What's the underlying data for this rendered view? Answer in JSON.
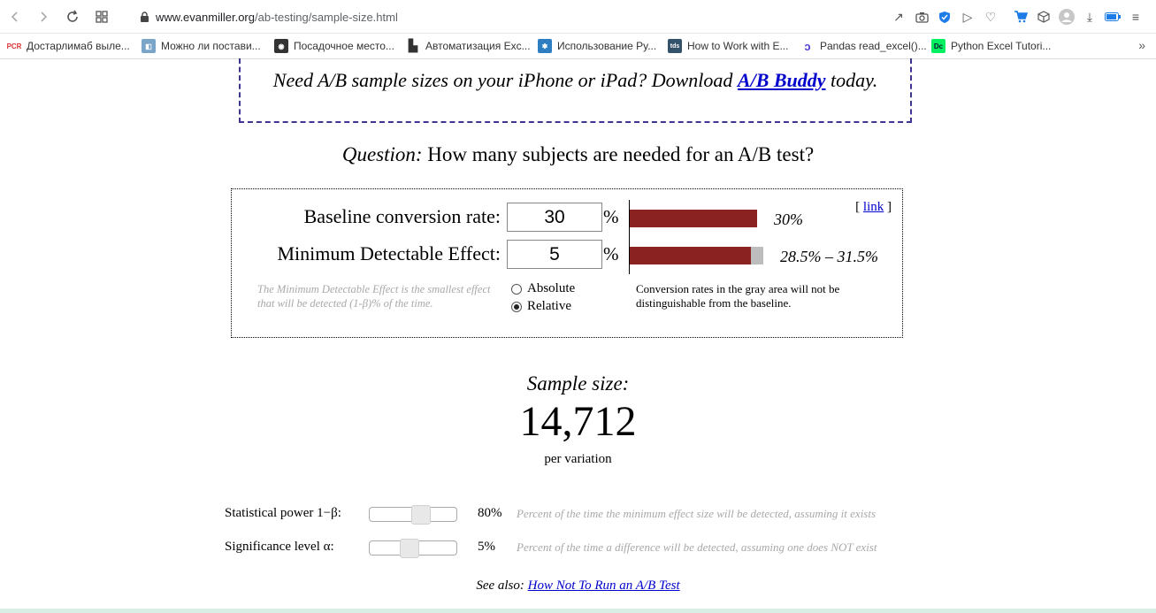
{
  "browser": {
    "url_domain": "www.evanmiller.org",
    "url_path": "/ab-testing/sample-size.html",
    "bookmarks": [
      {
        "label": "Достарлимаб выле...",
        "icon": "pcr-icon"
      },
      {
        "label": "Можно ли постави...",
        "icon": "page-icon"
      },
      {
        "label": "Посадочное место...",
        "icon": "camera-icon"
      },
      {
        "label": "Автоматизация Exc...",
        "icon": "document-icon"
      },
      {
        "label": "Использование Py...",
        "icon": "star-icon"
      },
      {
        "label": "How to Work with E...",
        "icon": "tds-icon"
      },
      {
        "label": "Pandas read_excel()...",
        "icon": "dataquest-icon"
      },
      {
        "label": "Python Excel Tutori...",
        "icon": "datacamp-icon"
      }
    ],
    "more_label": "»"
  },
  "promo": {
    "text_before": "Need A/B sample sizes on your iPhone or iPad? Download ",
    "link": "A/B Buddy",
    "text_after": " today."
  },
  "question": {
    "label": "Question:",
    "text": " How many subjects are needed for an A/B test?"
  },
  "calculator": {
    "link_open": "[ ",
    "link_label": "link",
    "link_close": " ]",
    "baseline": {
      "label": "Baseline conversion rate:",
      "value": "30",
      "unit": "%",
      "bar_text": "30%",
      "rate": 0.3
    },
    "mde": {
      "label": "Minimum Detectable Effect:",
      "value": "5",
      "unit": "%",
      "bar_text": "28.5% – 31.5%",
      "low": 0.285,
      "high": 0.315
    },
    "hint": "The Minimum Detectable Effect is the smallest effect that will be detected (1-β)% of the time.",
    "options": [
      "Absolute",
      "Relative"
    ],
    "selected_option": "Relative",
    "gray_note": "Conversion rates in the gray area will not be distinguishable from the baseline."
  },
  "result": {
    "label": "Sample size:",
    "value": "14,712",
    "sub": "per variation"
  },
  "params": {
    "power": {
      "label": "Statistical power 1−β:",
      "value": "80%",
      "level": 0.8,
      "desc": "Percent of the time the minimum effect size will be detected, assuming it exists"
    },
    "significance": {
      "label": "Significance level α:",
      "value": "5%",
      "level": 0.05,
      "desc": "Percent of the time a difference will be detected, assuming one does NOT exist"
    }
  },
  "see_also": {
    "label": "See also: ",
    "link": "How Not To Run an A/B Test"
  },
  "colors": {
    "bar_red": "#8b2222",
    "bar_gray": "#bdbdbd",
    "link": "#0000cc",
    "promo_border": "#3d3590"
  }
}
